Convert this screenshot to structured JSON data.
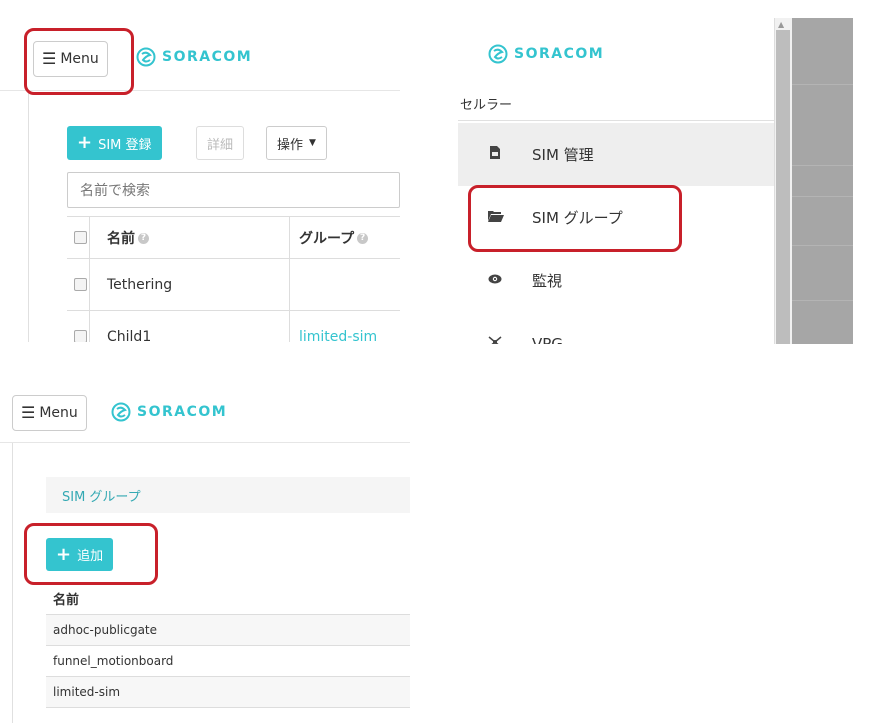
{
  "brand": {
    "name": "SORACOM",
    "color": "#34c4cf",
    "logo_icon": "soracom-logo-icon"
  },
  "highlight_color": "#c8202a",
  "panel1": {
    "menu_label": "Menu",
    "menu_icon": "hamburger-icon",
    "toolbar": {
      "register_label": "SIM 登録",
      "details_label": "詳細",
      "actions_label": "操作"
    },
    "search_placeholder": "名前で検索",
    "columns": [
      "名前",
      "グループ"
    ],
    "rows": [
      {
        "name": "Tethering",
        "group": ""
      },
      {
        "name": "Child1",
        "group": "limited-sim"
      }
    ]
  },
  "panel2": {
    "section_label": "セルラー",
    "nav_items": [
      {
        "label": "SIM 管理",
        "icon": "sim-card-icon",
        "active": true
      },
      {
        "label": "SIM グループ",
        "icon": "folder-open-icon",
        "active": false
      },
      {
        "label": "監視",
        "icon": "eye-icon",
        "active": false
      },
      {
        "label": "VPG",
        "icon": "vpg-network-icon",
        "active": false
      }
    ]
  },
  "panel3": {
    "menu_label": "Menu",
    "breadcrumb": "SIM グループ",
    "add_label": "追加",
    "column_header": "名前",
    "groups": [
      "adhoc-publicgate",
      "funnel_motionboard",
      "limited-sim"
    ]
  }
}
